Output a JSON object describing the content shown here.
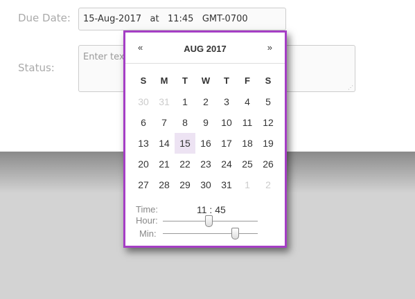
{
  "form": {
    "due_label": "Due Date:",
    "due_value": "15-Aug-2017   at   11:45   GMT-0700",
    "status_label": "Status:",
    "status_placeholder": "Enter text"
  },
  "picker": {
    "prev": "«",
    "next": "»",
    "title": "AUG 2017",
    "weekdays": [
      "S",
      "M",
      "T",
      "W",
      "T",
      "F",
      "S"
    ],
    "weeks": [
      [
        "30",
        "31",
        "1",
        "2",
        "3",
        "4",
        "5"
      ],
      [
        "6",
        "7",
        "8",
        "9",
        "10",
        "11",
        "12"
      ],
      [
        "13",
        "14",
        "15",
        "16",
        "17",
        "18",
        "19"
      ],
      [
        "20",
        "21",
        "22",
        "23",
        "24",
        "25",
        "26"
      ],
      [
        "27",
        "28",
        "29",
        "30",
        "31",
        "1",
        "2"
      ]
    ],
    "selected": "15",
    "time_label": "Time:",
    "time_value": "11 : 45",
    "hour_label": "Hour:",
    "min_label": "Min:",
    "hour": 11,
    "hour_max": 23,
    "minute": 45,
    "minute_max": 59
  },
  "colors": {
    "accent": "#a53ec5",
    "selected": "#ede3f3"
  }
}
